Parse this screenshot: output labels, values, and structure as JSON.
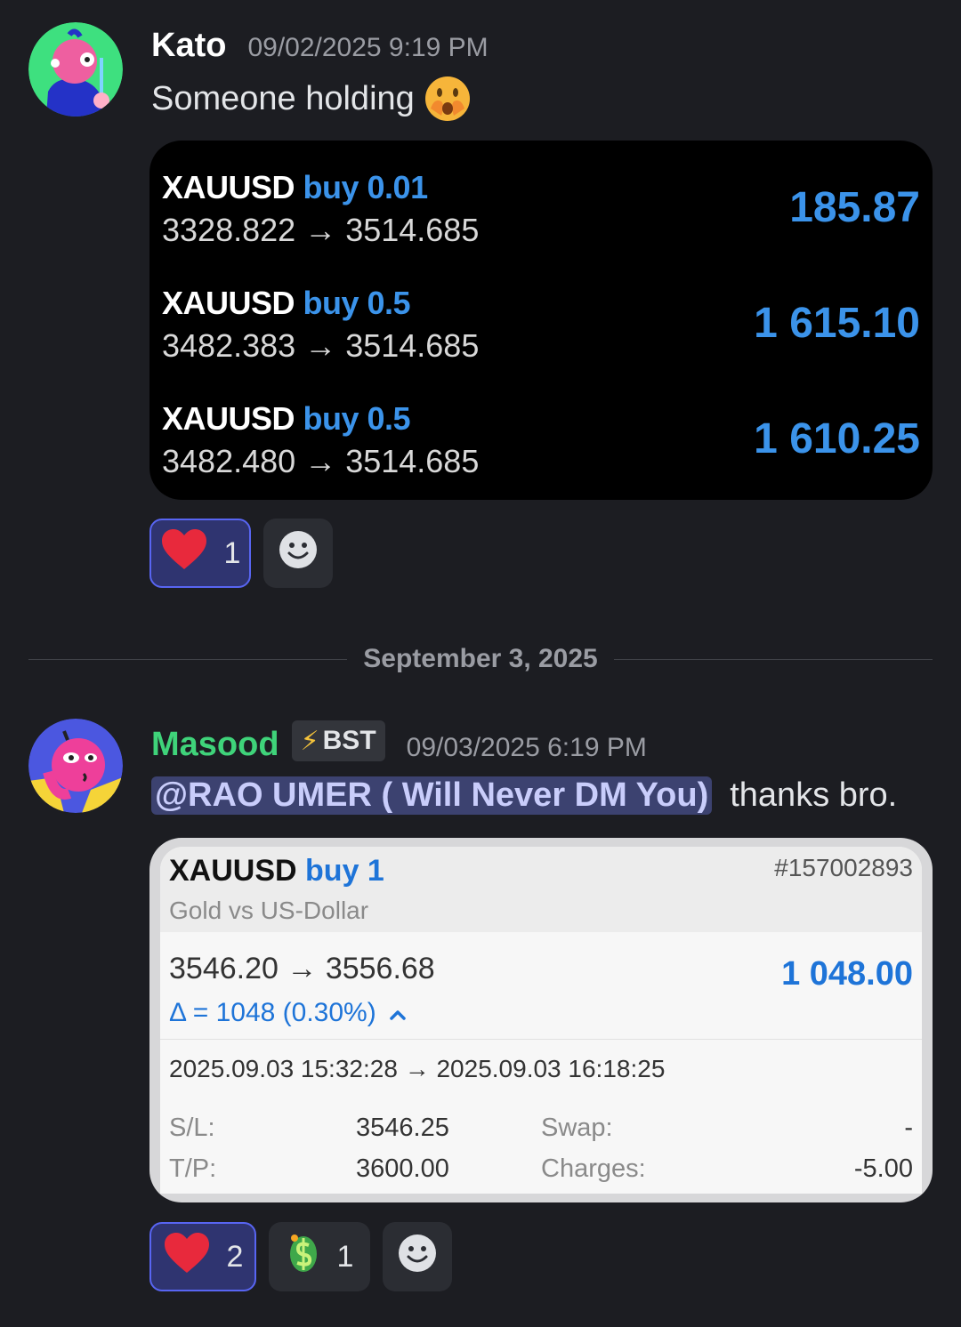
{
  "messages": [
    {
      "username": "Kato",
      "timestamp": "09/02/2025 9:19 PM",
      "text": "Someone holding",
      "trades": [
        {
          "symbol": "XAUUSD",
          "side": "buy 0.01",
          "open": "3328.822",
          "close": "3514.685",
          "profit": "185.87"
        },
        {
          "symbol": "XAUUSD",
          "side": "buy 0.5",
          "open": "3482.383",
          "close": "3514.685",
          "profit": "1 615.10"
        },
        {
          "symbol": "XAUUSD",
          "side": "buy 0.5",
          "open": "3482.480",
          "close": "3514.685",
          "profit": "1 610.25"
        }
      ],
      "reactions": [
        {
          "count": "1"
        }
      ]
    },
    {
      "username": "Masood",
      "tag": "BST",
      "timestamp": "09/03/2025 6:19 PM",
      "mention": "@RAO UMER ( Will Never DM You)",
      "text": "thanks bro.",
      "trade": {
        "symbol": "XAUUSD",
        "side": "buy 1",
        "ticket": "#157002893",
        "description": "Gold vs US-Dollar",
        "open": "3546.20",
        "close": "3556.68",
        "profit": "1 048.00",
        "delta": "Δ = 1048 (0.30%)",
        "open_time": "2025.09.03 15:32:28",
        "close_time": "2025.09.03 16:18:25",
        "sl_label": "S/L:",
        "sl": "3546.25",
        "tp_label": "T/P:",
        "tp": "3600.00",
        "swap_label": "Swap:",
        "swap": "-",
        "charges_label": "Charges:",
        "charges": "-5.00"
      },
      "reactions": [
        {
          "count": "2"
        },
        {
          "count": "1"
        }
      ]
    }
  ],
  "divider": {
    "label": "September 3, 2025"
  },
  "arrow": "→",
  "colors": {
    "accent": "#3b93ea",
    "kato": "#ffffff",
    "masood": "#3fd37a",
    "mention_bg": "#3c4270"
  }
}
